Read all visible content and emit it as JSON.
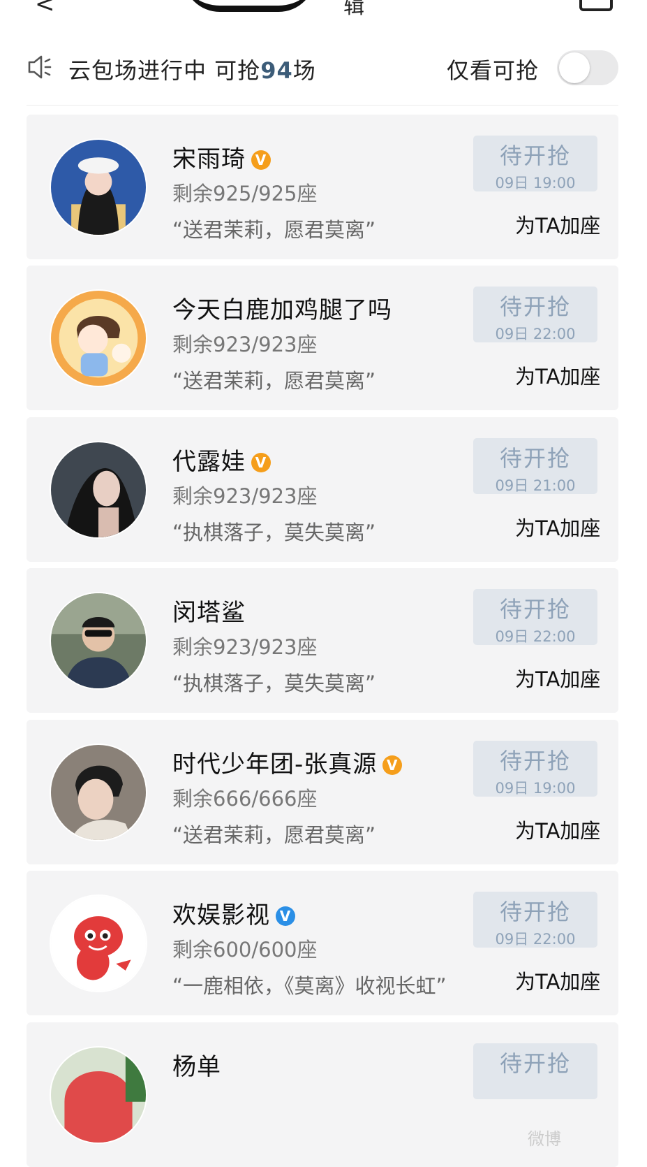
{
  "header": {
    "back_icon": "chevron-left-icon",
    "title_partial": "辑"
  },
  "notice": {
    "prefix": "云包场进行中 可抢",
    "count": "94",
    "suffix": "场",
    "only_available_label": "仅看可抢",
    "toggle_state": "off"
  },
  "cards": [
    {
      "name": "宋雨琦",
      "badge": "V",
      "badge_color": "#f59e1b",
      "seats": "剩余925/925座",
      "slogan": "“送君茉莉，愿君莫离”",
      "button_label": "待开抢",
      "button_time": "09日 19:00",
      "add_seat": "为TA加座"
    },
    {
      "name": "今天白鹿加鸡腿了吗",
      "badge": "",
      "badge_color": "",
      "seats": "剩余923/923座",
      "slogan": "“送君茉莉，愿君莫离”",
      "button_label": "待开抢",
      "button_time": "09日 22:00",
      "add_seat": "为TA加座"
    },
    {
      "name": "代露娃",
      "badge": "V",
      "badge_color": "#f59e1b",
      "seats": "剩余923/923座",
      "slogan": "“执棋落子，莫失莫离”",
      "button_label": "待开抢",
      "button_time": "09日 21:00",
      "add_seat": "为TA加座"
    },
    {
      "name": "闵塔鲨",
      "badge": "",
      "badge_color": "",
      "seats": "剩余923/923座",
      "slogan": "“执棋落子，莫失莫离”",
      "button_label": "待开抢",
      "button_time": "09日 22:00",
      "add_seat": "为TA加座"
    },
    {
      "name": "时代少年团-张真源",
      "badge": "V",
      "badge_color": "#f59e1b",
      "seats": "剩余666/666座",
      "slogan": "“送君茉莉，愿君莫离”",
      "button_label": "待开抢",
      "button_time": "09日 19:00",
      "add_seat": "为TA加座"
    },
    {
      "name": "欢娱影视",
      "badge": "V",
      "badge_color": "#2b8fe6",
      "seats": "剩余600/600座",
      "slogan": "“一鹿相依，《莫离》收视长虹”",
      "button_label": "待开抢",
      "button_time": "09日 22:00",
      "add_seat": "为TA加座"
    },
    {
      "name": "杨单",
      "badge": "",
      "badge_color": "",
      "seats": "",
      "slogan": "",
      "button_label": "待开抢",
      "button_time": "",
      "add_seat": ""
    }
  ],
  "colors": {
    "card_bg": "#f4f4f5",
    "button_bg": "#e1e6ec",
    "button_text": "#8ea2b8",
    "count_accent": "#3c5c78"
  },
  "watermark": "微博"
}
